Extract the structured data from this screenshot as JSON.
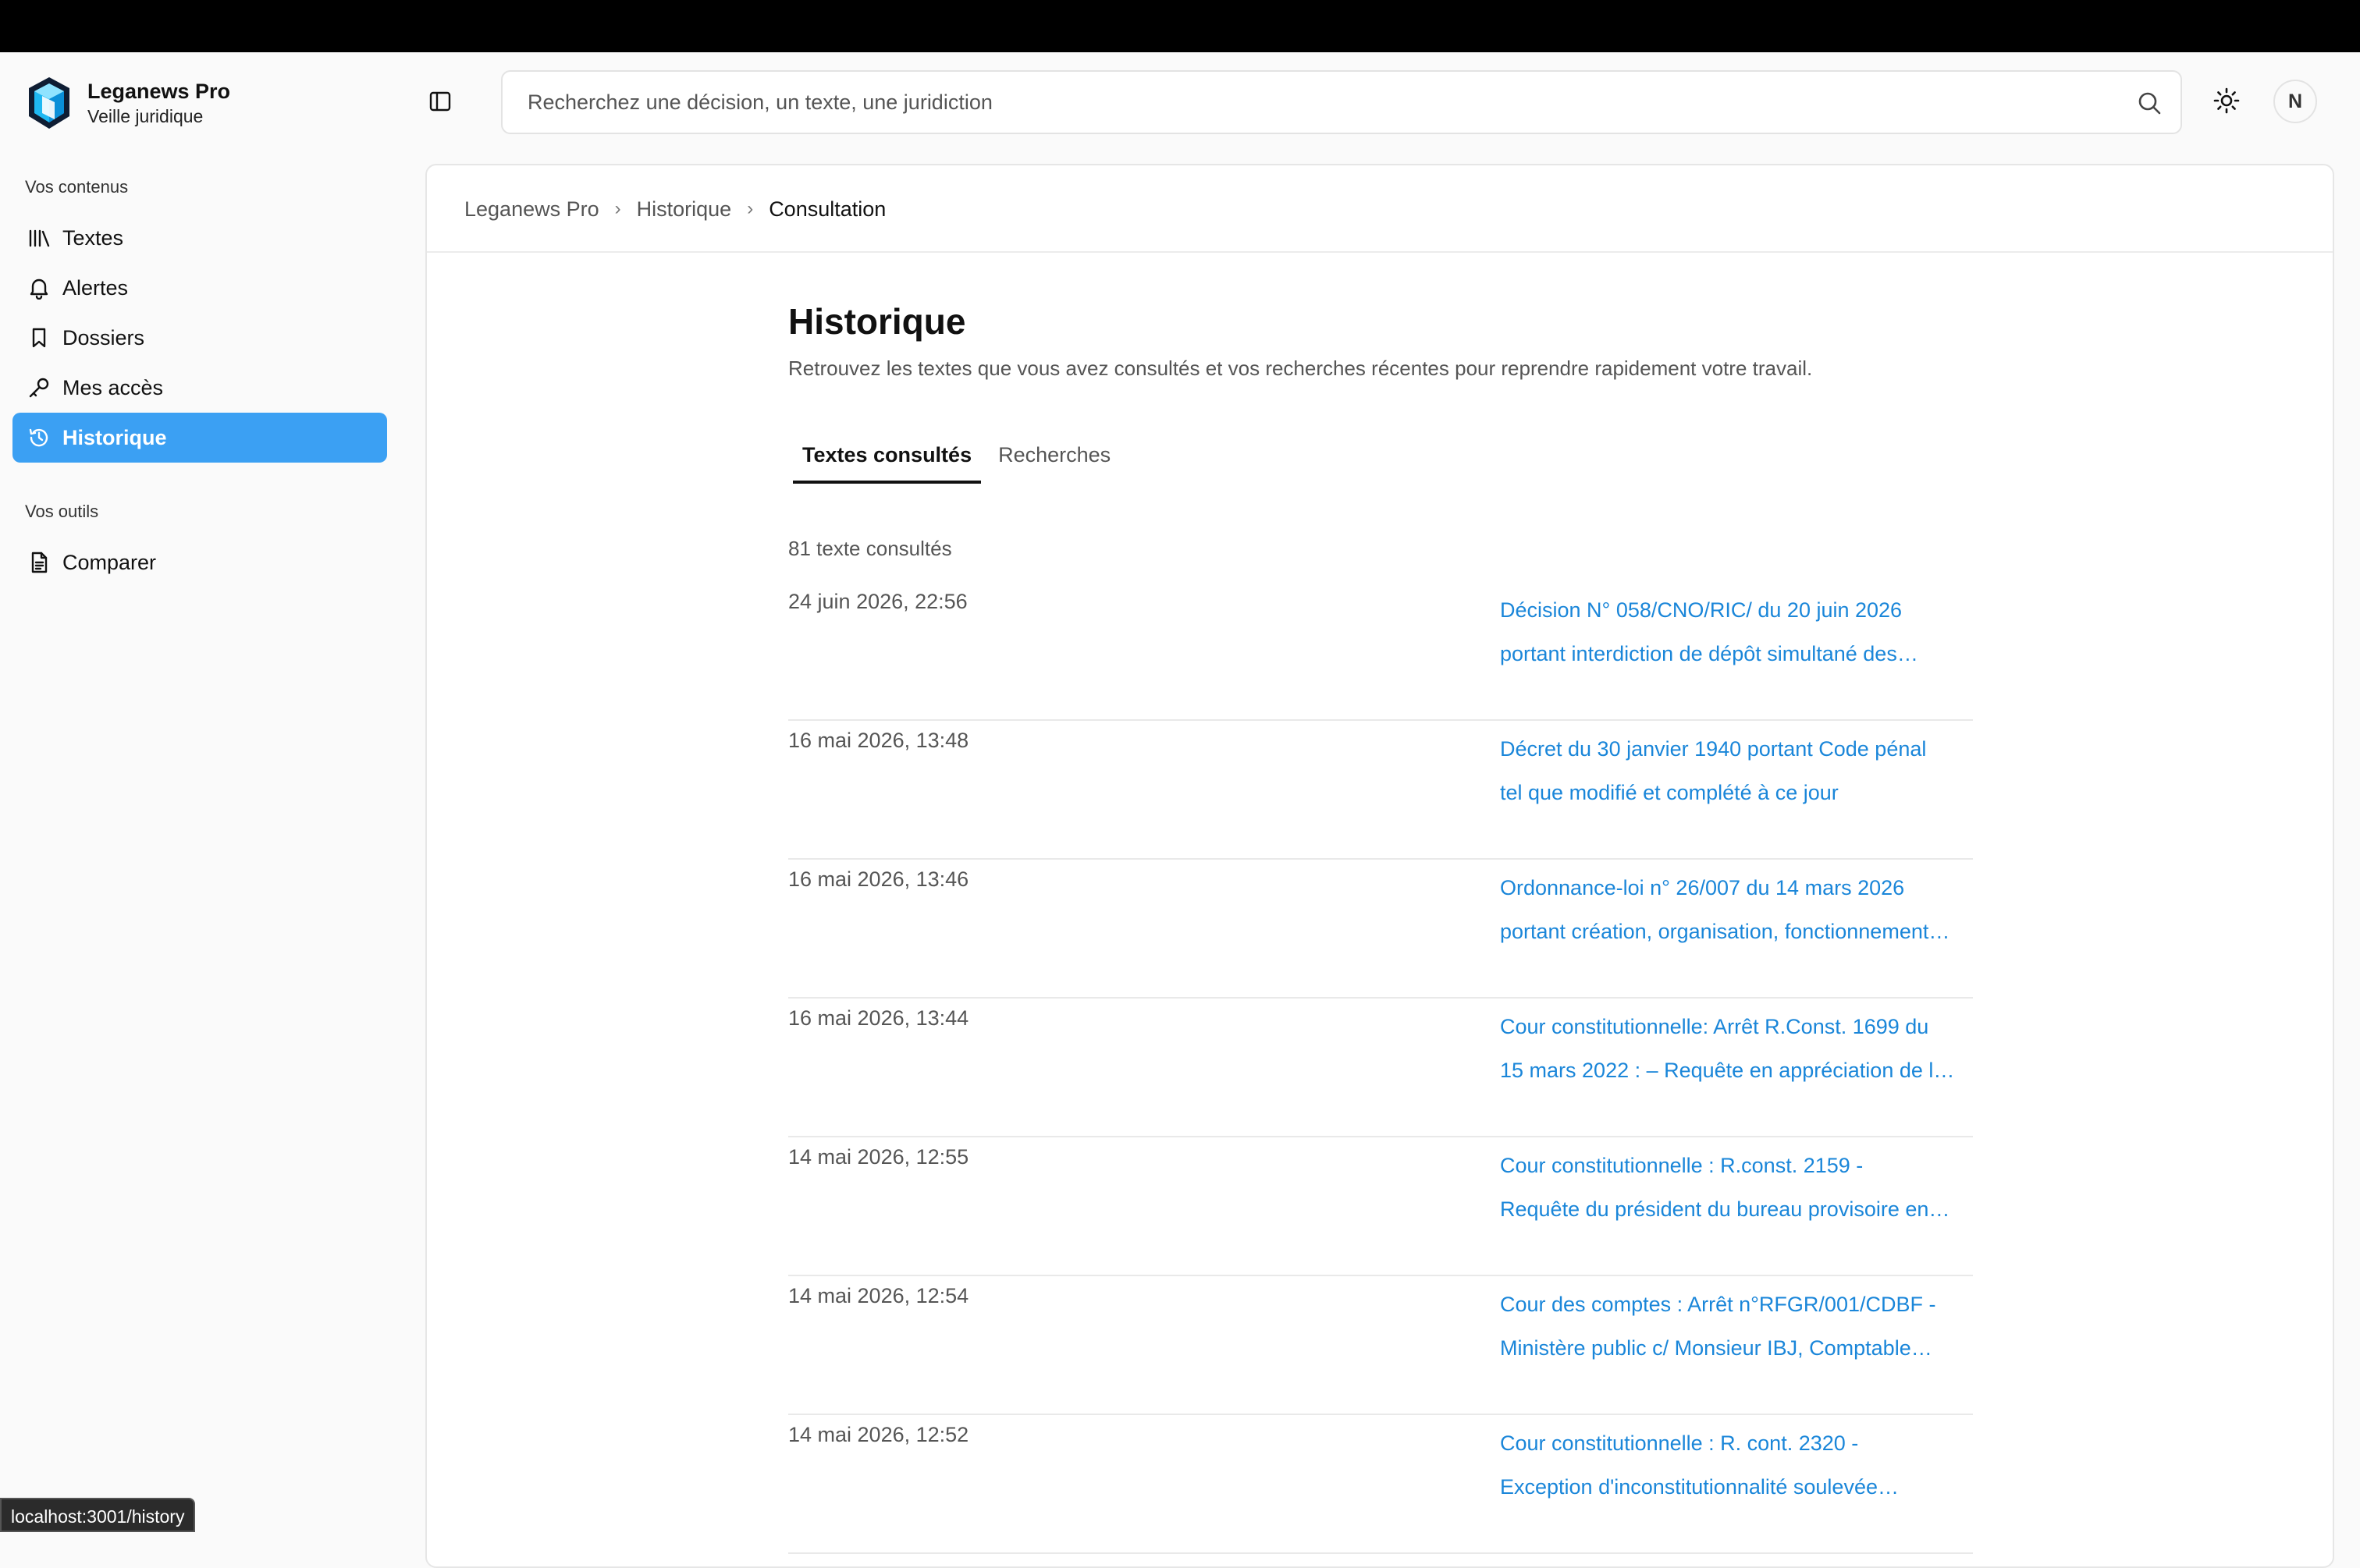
{
  "app": {
    "name": "Leganews Pro",
    "subtitle": "Veille juridique"
  },
  "sidebar": {
    "section_contents": "Vos contenus",
    "items": [
      {
        "label": "Textes",
        "icon": "library-icon"
      },
      {
        "label": "Alertes",
        "icon": "bell-icon"
      },
      {
        "label": "Dossiers",
        "icon": "bookmark-icon"
      },
      {
        "label": "Mes accès",
        "icon": "key-icon"
      },
      {
        "label": "Historique",
        "icon": "history-icon",
        "active": true
      }
    ],
    "section_tools": "Vos outils",
    "tools": [
      {
        "label": "Comparer",
        "icon": "document-icon"
      }
    ]
  },
  "search": {
    "placeholder": "Recherchez une décision, un texte, une juridiction"
  },
  "user": {
    "initial": "N"
  },
  "breadcrumb": [
    "Leganews Pro",
    "Historique",
    "Consultation"
  ],
  "page": {
    "title": "Historique",
    "description": "Retrouvez les textes que vous avez consultés et vos recherches récentes pour reprendre rapidement votre travail."
  },
  "tabs": [
    {
      "label": "Textes consultés",
      "active": true
    },
    {
      "label": "Recherches",
      "active": false
    }
  ],
  "count_text": "81 texte consultés",
  "history": [
    {
      "date": "24 juin 2026, 22:56",
      "line1": "Décision N° 058/CNO/RIC/ du 20 juin 2026",
      "line2": "portant interdiction de dépôt simultané des…"
    },
    {
      "date": "16 mai 2026, 13:48",
      "line1": "Décret du 30 janvier 1940 portant Code pénal",
      "line2": "tel que modifié et complété à ce jour"
    },
    {
      "date": "16 mai 2026, 13:46",
      "line1": "Ordonnance-loi n° 26/007 du 14 mars 2026",
      "line2": "portant création, organisation, fonctionnement…"
    },
    {
      "date": "16 mai 2026, 13:44",
      "line1": "Cour constitutionnelle: Arrêt R.Const. 1699 du",
      "line2": "15 mars 2022 : – Requête en appréciation de l…"
    },
    {
      "date": "14 mai 2026, 12:55",
      "line1": "Cour constitutionnelle : R.const. 2159 -",
      "line2": "Requête du président du bureau provisoire en…"
    },
    {
      "date": "14 mai 2026, 12:54",
      "line1": "Cour des comptes : Arrêt n°RFGR/001/CDBF -",
      "line2": "Ministère public c/ Monsieur IBJ, Comptable…"
    },
    {
      "date": "14 mai 2026, 12:52",
      "line1": "Cour constitutionnelle : R. cont. 2320 -",
      "line2": "Exception d'inconstitutionnalité soulevée…"
    }
  ],
  "status_url": "localhost:3001/history",
  "colors": {
    "accent": "#3ba0f3",
    "link": "#1a86d9"
  }
}
